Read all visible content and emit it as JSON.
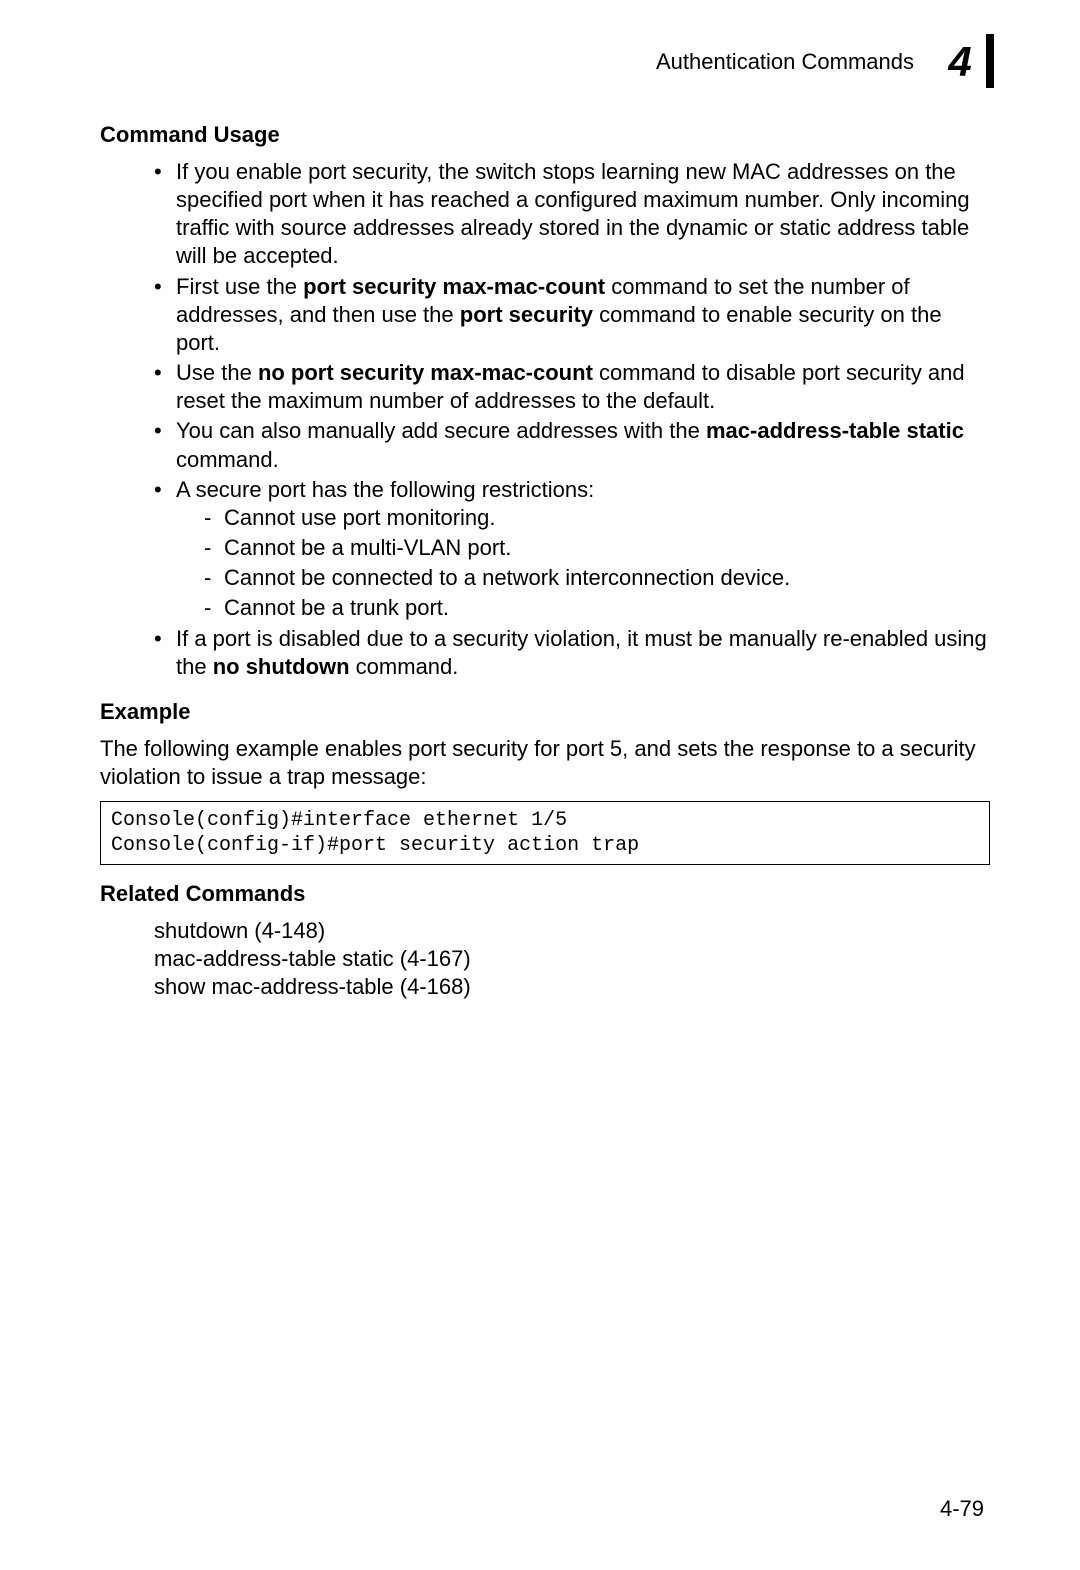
{
  "header": {
    "title": "Authentication Commands",
    "chapter": "4"
  },
  "sections": {
    "commandUsage": {
      "heading": "Command Usage",
      "items": {
        "b1": "If you enable port security, the switch stops learning new MAC addresses on the specified port when it has reached a configured maximum number. Only incoming traffic with source addresses already stored in the dynamic or static address table will be accepted.",
        "b2_pre": "First use the ",
        "b2_bold1": "port security max-mac-count",
        "b2_mid": " command to set the number of addresses, and then use the ",
        "b2_bold2": "port security",
        "b2_post": " command to enable security on the port.",
        "b3_pre": "Use the ",
        "b3_bold": "no port security max-mac-count",
        "b3_post": " command to disable port security and reset the maximum number of addresses to the default.",
        "b4_pre": "You can also manually add secure addresses with the ",
        "b4_bold": "mac-address-table static",
        "b4_post": " command.",
        "b5": "A secure port has the following restrictions:",
        "b5_s1": "Cannot use port monitoring.",
        "b5_s2": "Cannot be a multi-VLAN port.",
        "b5_s3": "Cannot be connected to a network interconnection device.",
        "b5_s4": "Cannot be a trunk port.",
        "b6_pre": "If a port is disabled due to a security violation, it must be manually re-enabled using the ",
        "b6_bold": "no shutdown",
        "b6_post": " command."
      }
    },
    "example": {
      "heading": "Example",
      "intro": "The following example enables port security for port 5, and sets the response to a security violation to issue a trap message:",
      "code": "Console(config)#interface ethernet 1/5\nConsole(config-if)#port security action trap"
    },
    "related": {
      "heading": "Related Commands",
      "r1": "shutdown (4-148)",
      "r2": "mac-address-table static (4-167)",
      "r3": "show mac-address-table (4-168)"
    }
  },
  "pageNumber": "4-79"
}
